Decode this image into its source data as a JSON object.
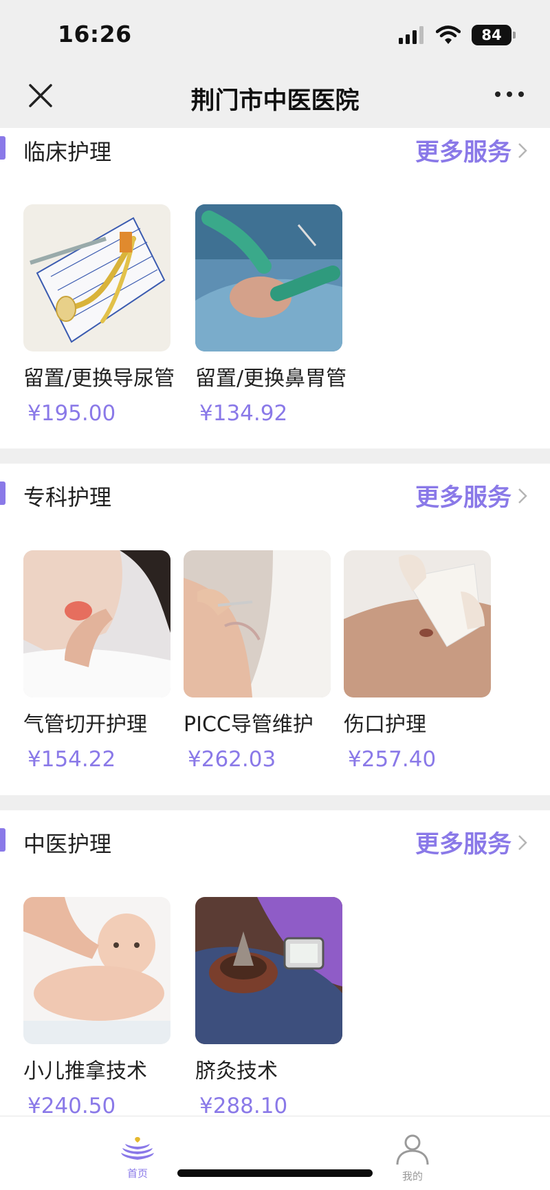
{
  "status": {
    "time": "16:26",
    "battery": "84"
  },
  "nav": {
    "title": "荆门市中医医院"
  },
  "sections": [
    {
      "title": "临床护理",
      "more": "更多服务",
      "items": [
        {
          "name": "留置/更换导尿管",
          "price": "¥195.00"
        },
        {
          "name": "留置/更换鼻胃管",
          "price": "¥134.92"
        }
      ]
    },
    {
      "title": "专科护理",
      "more": "更多服务",
      "items": [
        {
          "name": "气管切开护理",
          "price": "¥154.22"
        },
        {
          "name": "PICC导管维护",
          "price": "¥262.03"
        },
        {
          "name": "伤口护理",
          "price": "¥257.40"
        }
      ]
    },
    {
      "title": "中医护理",
      "more": "更多服务",
      "items": [
        {
          "name": "小儿推拿技术",
          "price": "¥240.50"
        },
        {
          "name": "脐灸技术",
          "price": "¥288.10"
        }
      ]
    }
  ],
  "tabbar": {
    "home": "首页",
    "mine": "我的"
  },
  "colors": {
    "accent": "#8a79e8",
    "background_gray": "#efefef"
  }
}
